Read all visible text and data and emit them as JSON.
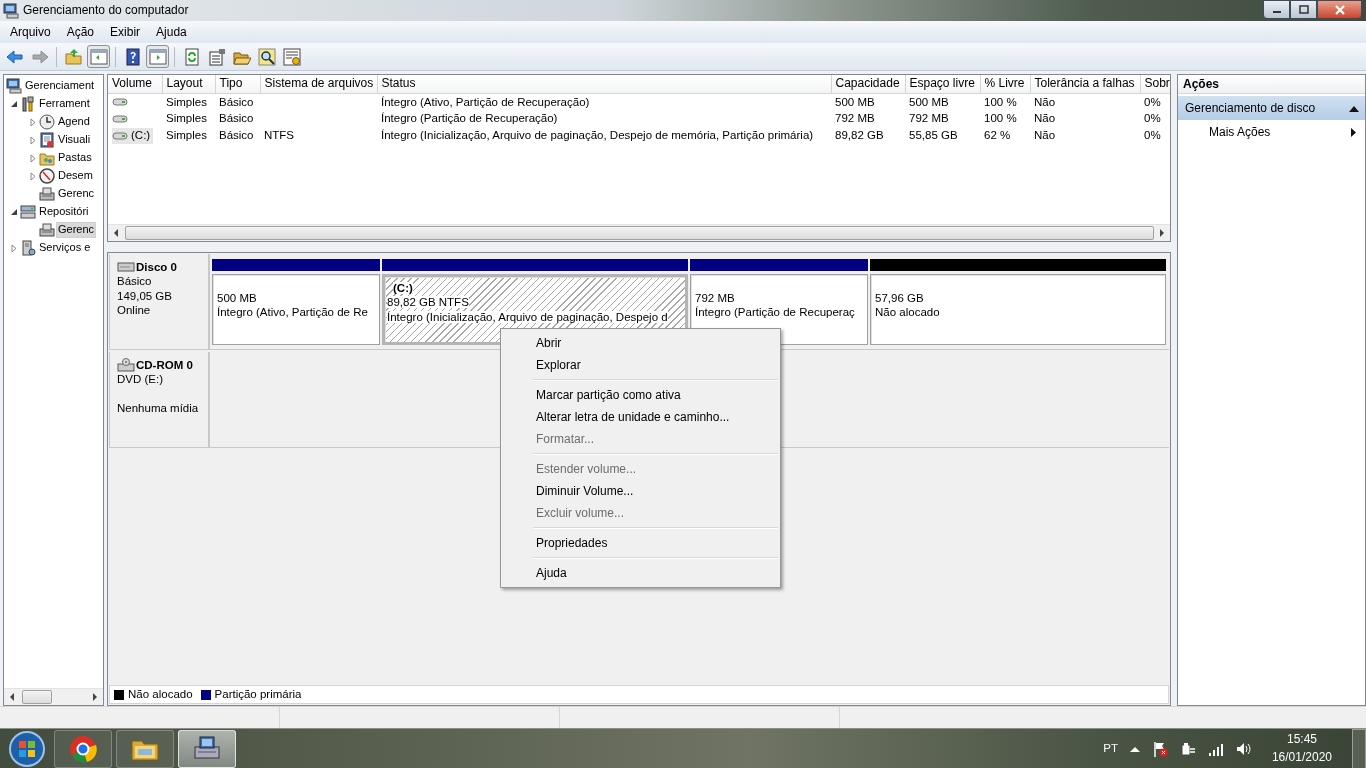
{
  "window": {
    "title": "Gerenciamento do computador"
  },
  "menu": [
    "Arquivo",
    "Ação",
    "Exibir",
    "Ajuda"
  ],
  "toolbar": [
    {
      "disabled": false,
      "pressed": false
    },
    {
      "disabled": true,
      "pressed": false
    },
    {
      "disabled": false,
      "pressed": false
    },
    {
      "disabled": false,
      "pressed": true
    },
    {
      "disabled": false,
      "pressed": false
    },
    {
      "disabled": false,
      "pressed": true
    },
    {
      "disabled": false,
      "pressed": false
    },
    {
      "disabled": false,
      "pressed": false
    },
    {
      "disabled": false,
      "pressed": false
    },
    {
      "disabled": false,
      "pressed": false
    },
    {
      "disabled": false,
      "pressed": false
    }
  ],
  "tree": [
    {
      "label": "Gerenciament",
      "kind": "root",
      "selected": false,
      "children": [
        {
          "label": "Ferrament",
          "kind": "branch",
          "expanded": true,
          "selected": false,
          "children": [
            {
              "label": "Agend",
              "kind": "branch",
              "expanded": false,
              "selected": false
            },
            {
              "label": "Visuali",
              "kind": "branch",
              "expanded": false,
              "selected": false
            },
            {
              "label": "Pastas",
              "kind": "branch",
              "expanded": false,
              "selected": false
            },
            {
              "label": "Desem",
              "kind": "branch",
              "expanded": false,
              "selected": false
            },
            {
              "label": "Gerenc",
              "kind": "leaf",
              "selected": false
            }
          ]
        },
        {
          "label": "Repositóri",
          "kind": "branch",
          "expanded": true,
          "selected": false,
          "children": [
            {
              "label": "Gerenc",
              "kind": "leaf",
              "selected": true
            }
          ]
        },
        {
          "label": "Serviços e",
          "kind": "branch",
          "expanded": false,
          "selected": false
        }
      ]
    }
  ],
  "table": {
    "columns": [
      "Volume",
      "Layout",
      "Tipo",
      "Sistema de arquivos",
      "Status",
      "Capacidade",
      "Espaço livre",
      "% Livre",
      "Tolerância a falhas",
      "Sobr"
    ],
    "rows": [
      {
        "selected": false,
        "layout": "Simples",
        "type": "Básico",
        "status": "Íntegro (Ativo, Partição de Recuperação)",
        "capacity": "500 MB",
        "free_space": "500 MB",
        "percent_free": "100 %",
        "fault_tolerance": "Não",
        "column_10": "0%"
      },
      {
        "selected": false,
        "layout": "Simples",
        "type": "Básico",
        "status": "Íntegro (Partição de Recuperação)",
        "capacity": "792 MB",
        "free_space": "792 MB",
        "percent_free": "100 %",
        "fault_tolerance": "Não",
        "column_10": "0%"
      },
      {
        "selected": true,
        "volume": "(C:)",
        "layout": "Simples",
        "type": "Básico",
        "file_system": "NTFS",
        "status": "Íntegro (Inicialização, Arquivo de paginação, Despejo de memória, Partição primária)",
        "capacity": "89,82 GB",
        "free_space": "55,85 GB",
        "percent_free": "62 %",
        "fault_tolerance": "Não",
        "column_10": "0%"
      }
    ]
  },
  "disks": [
    {
      "kind": "disk",
      "name": "Disco 0",
      "type": "Básico",
      "size": "149,05 GB",
      "state": "Online",
      "partitions": [
        {
          "color": "#000080",
          "selected": false,
          "size": "500 MB",
          "status": "Íntegro (Ativo, Partição de Re"
        },
        {
          "color": "#000080",
          "selected": true,
          "label": "(C:)",
          "size": "89,82 GB NTFS",
          "status": "Íntegro (Inicialização, Arquivo de paginação, Despejo d"
        },
        {
          "color": "#000080",
          "selected": false,
          "size": "792 MB",
          "status": "Íntegro (Partição de Recuperaç"
        },
        {
          "color": "#000000",
          "selected": false,
          "size": "57,96 GB",
          "status": "Não alocado"
        }
      ]
    },
    {
      "kind": "cdrom",
      "name": "CD-ROM 0",
      "type": "DVD (E:)",
      "state": "Nenhuma mídia"
    }
  ],
  "legend": [
    {
      "label": "Não alocado",
      "color": "#000000"
    },
    {
      "label": "Partição primária",
      "color": "#000080"
    }
  ],
  "actions": {
    "title": "Ações",
    "sections": [
      {
        "label": "Gerenciamento de disco",
        "expanded": true,
        "items": [
          "Mais Ações"
        ]
      }
    ]
  },
  "context_menu": [
    {
      "kind": "item",
      "label": "Abrir",
      "disabled": false
    },
    {
      "kind": "item",
      "label": "Explorar",
      "disabled": false
    },
    {
      "kind": "separator"
    },
    {
      "kind": "item",
      "label": "Marcar partição como ativa",
      "disabled": false
    },
    {
      "kind": "item",
      "label": "Alterar letra de unidade e caminho...",
      "disabled": false
    },
    {
      "kind": "item",
      "label": "Formatar...",
      "disabled": true
    },
    {
      "kind": "separator"
    },
    {
      "kind": "item",
      "label": "Estender volume...",
      "disabled": true
    },
    {
      "kind": "item",
      "label": "Diminuir Volume...",
      "disabled": false
    },
    {
      "kind": "item",
      "label": "Excluir volume...",
      "disabled": true
    },
    {
      "kind": "separator"
    },
    {
      "kind": "item",
      "label": "Propriedades",
      "disabled": false
    },
    {
      "kind": "separator"
    },
    {
      "kind": "item",
      "label": "Ajuda",
      "disabled": false
    }
  ],
  "taskbar": {
    "apps": [
      {
        "selected": false
      },
      {
        "selected": false
      },
      {
        "selected": true
      }
    ],
    "language": "PT",
    "time": "15:45",
    "date": "16/01/2020"
  }
}
